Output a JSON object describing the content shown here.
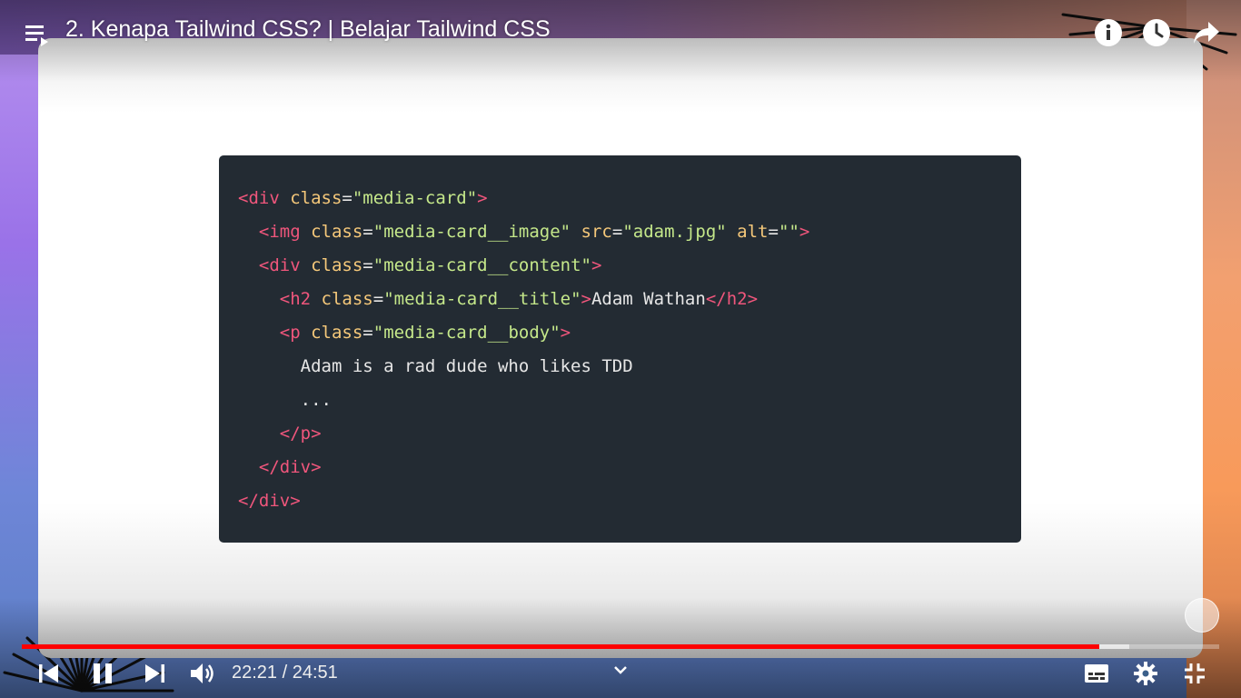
{
  "player": {
    "title": "2. Kenapa Tailwind CSS? | Belajar Tailwind CSS",
    "current_time": "22:21",
    "separator": " / ",
    "duration": "24:51",
    "progress": 0.8995,
    "buffered": 0.925,
    "accent_color": "#ff0000"
  },
  "icons": {
    "playlist": "playlist-icon",
    "info": "info-icon",
    "watch_later": "clock-icon",
    "share": "share-icon",
    "prev": "skip-previous-icon",
    "pause": "pause-icon",
    "next": "skip-next-icon",
    "volume": "volume-icon",
    "chevron": "chevron-down-icon",
    "subtitles": "subtitles-icon",
    "settings": "gear-icon",
    "exit_fullscreen": "exit-fullscreen-icon"
  },
  "code": {
    "lines": [
      [
        {
          "t": "tag",
          "v": "<div "
        },
        {
          "t": "attr",
          "v": "class"
        },
        {
          "t": "txt",
          "v": "="
        },
        {
          "t": "str",
          "v": "\"media-card\""
        },
        {
          "t": "tag",
          "v": ">"
        }
      ],
      [
        {
          "t": "txt",
          "v": "  "
        },
        {
          "t": "tag",
          "v": "<img "
        },
        {
          "t": "attr",
          "v": "class"
        },
        {
          "t": "txt",
          "v": "="
        },
        {
          "t": "str",
          "v": "\"media-card__image\""
        },
        {
          "t": "txt",
          "v": " "
        },
        {
          "t": "attr",
          "v": "src"
        },
        {
          "t": "txt",
          "v": "="
        },
        {
          "t": "str",
          "v": "\"adam.jpg\""
        },
        {
          "t": "txt",
          "v": " "
        },
        {
          "t": "attr",
          "v": "alt"
        },
        {
          "t": "txt",
          "v": "="
        },
        {
          "t": "str",
          "v": "\"\""
        },
        {
          "t": "tag",
          "v": ">"
        }
      ],
      [
        {
          "t": "txt",
          "v": "  "
        },
        {
          "t": "tag",
          "v": "<div "
        },
        {
          "t": "attr",
          "v": "class"
        },
        {
          "t": "txt",
          "v": "="
        },
        {
          "t": "str",
          "v": "\"media-card__content\""
        },
        {
          "t": "tag",
          "v": ">"
        }
      ],
      [
        {
          "t": "txt",
          "v": "    "
        },
        {
          "t": "tag",
          "v": "<h2 "
        },
        {
          "t": "attr",
          "v": "class"
        },
        {
          "t": "txt",
          "v": "="
        },
        {
          "t": "str",
          "v": "\"media-card__title\""
        },
        {
          "t": "tag",
          "v": ">"
        },
        {
          "t": "txt",
          "v": "Adam Wathan"
        },
        {
          "t": "tag",
          "v": "</h2>"
        }
      ],
      [
        {
          "t": "txt",
          "v": "    "
        },
        {
          "t": "tag",
          "v": "<p "
        },
        {
          "t": "attr",
          "v": "class"
        },
        {
          "t": "txt",
          "v": "="
        },
        {
          "t": "str",
          "v": "\"media-card__body\""
        },
        {
          "t": "tag",
          "v": ">"
        }
      ],
      [
        {
          "t": "txt",
          "v": "      Adam is a rad dude who likes TDD"
        }
      ],
      [
        {
          "t": "txt",
          "v": "      ..."
        }
      ],
      [
        {
          "t": "txt",
          "v": "    "
        },
        {
          "t": "tag",
          "v": "</p>"
        }
      ],
      [
        {
          "t": "txt",
          "v": "  "
        },
        {
          "t": "tag",
          "v": "</div>"
        }
      ],
      [
        {
          "t": "tag",
          "v": "</div>"
        }
      ]
    ]
  }
}
